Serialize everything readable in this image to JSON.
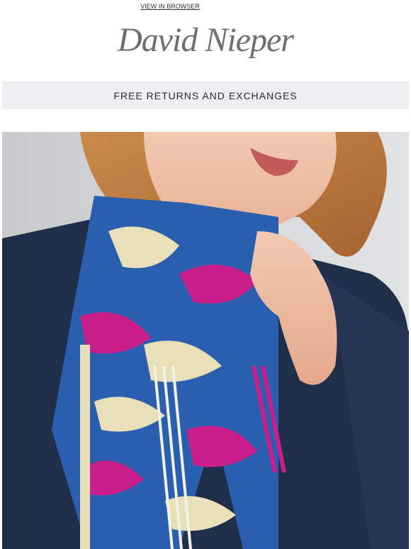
{
  "header": {
    "view_in_browser": "VIEW IN BROWSER",
    "logo_text": "David Nieper"
  },
  "banner": {
    "text": "FREE RETURNS AND EXCHANGES"
  },
  "hero": {
    "alt_subject": "woman-wearing-printed-scarf"
  },
  "colors": {
    "banner_bg": "#eeeff0",
    "logo": "#6e6e6e",
    "cardigan": "#1f2f4a",
    "scarf_blue": "#2a5fb0",
    "scarf_pink": "#c81f8a",
    "scarf_cream": "#e9dfb8"
  }
}
